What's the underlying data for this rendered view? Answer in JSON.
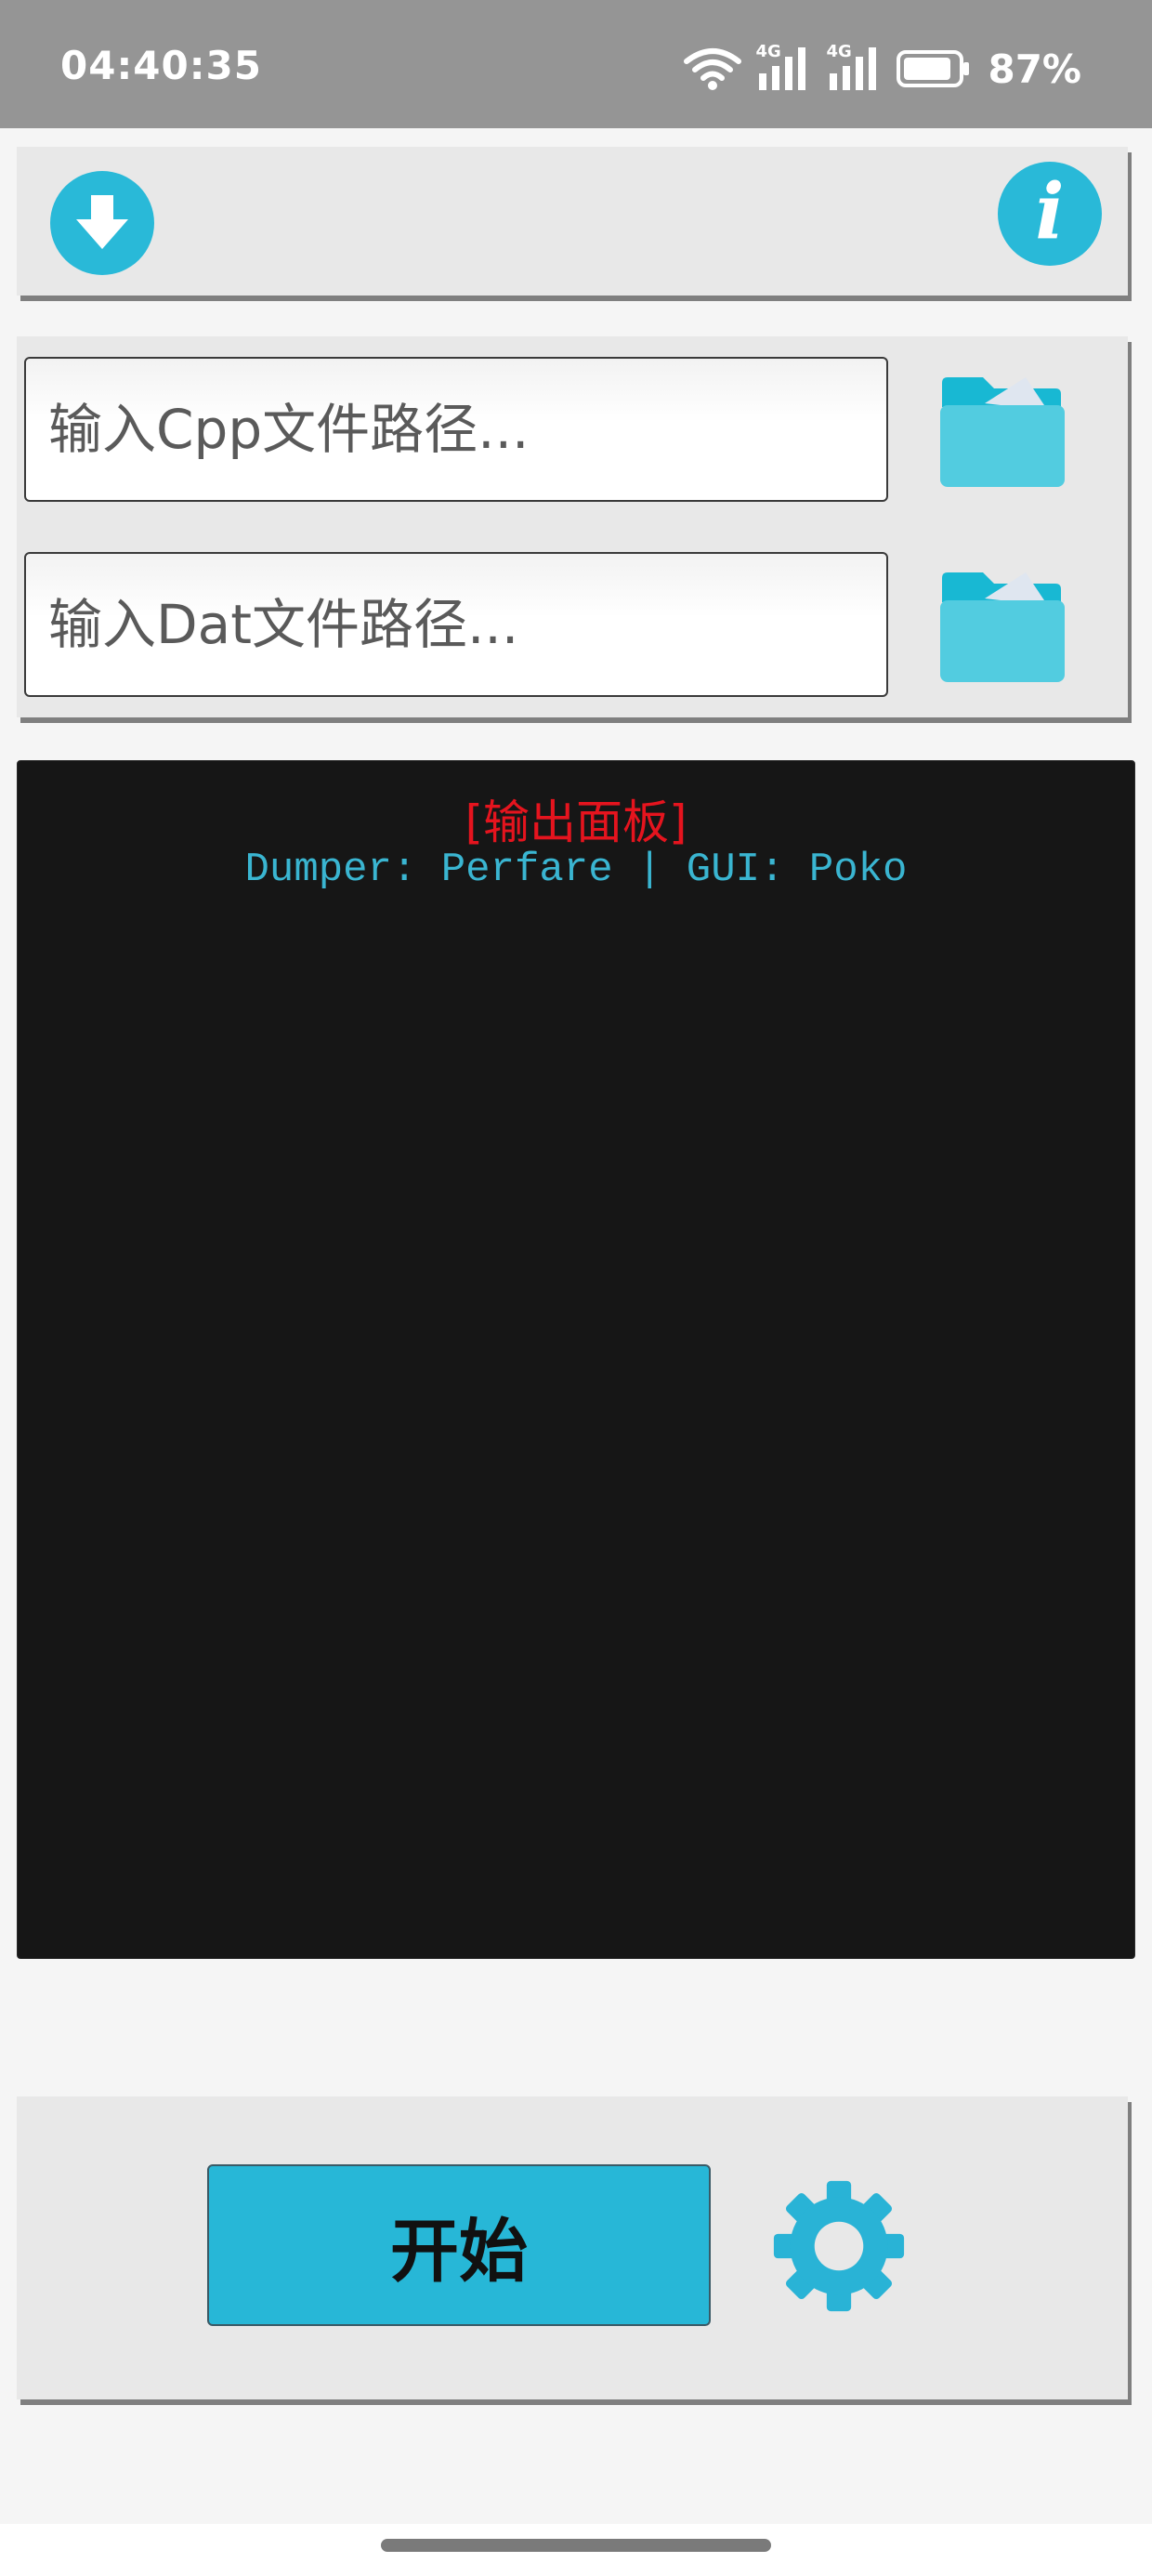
{
  "status_bar": {
    "time": "04:40:35",
    "network_1": "4G",
    "network_2": "4G",
    "battery": "87%",
    "battery_level": 0.87
  },
  "top_bar": {
    "download_icon": "download-arrow-icon",
    "info_icon": "info-icon",
    "info_glyph": "i"
  },
  "inputs": {
    "cpp_placeholder": "输入Cpp文件路径...",
    "cpp_value": "",
    "dat_placeholder": "输入Dat文件路径...",
    "dat_value": "",
    "folder_icon": "folder-icon"
  },
  "console": {
    "title": "[输出面板]",
    "credit": "Dumper: Perfare | GUI: Poko"
  },
  "controls": {
    "start_label": "开始",
    "settings_icon": "gear-icon"
  },
  "colors": {
    "accent": "#29b9d8",
    "console_bg": "#161616",
    "console_title": "#e5141e",
    "console_text": "#3ab5d1",
    "panel_bg": "#e8e8e8"
  }
}
